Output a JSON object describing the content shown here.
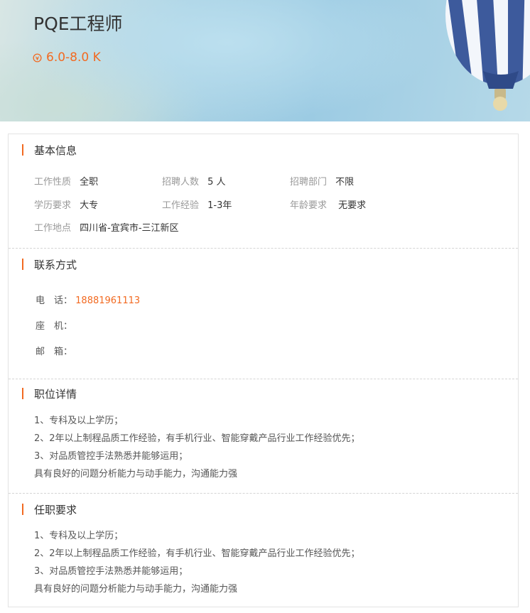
{
  "header": {
    "title": "PQE工程师",
    "salary": "6.0-8.0 K"
  },
  "basic_info": {
    "heading": "基本信息",
    "fields": [
      {
        "label": "工作性质",
        "value": "全职"
      },
      {
        "label": "招聘人数",
        "value": "5 人"
      },
      {
        "label": "招聘部门",
        "value": "不限"
      },
      {
        "label": "学历要求",
        "value": "大专"
      },
      {
        "label": "工作经验",
        "value": "1-3年"
      },
      {
        "label": "年龄要求",
        "value": "无要求"
      },
      {
        "label": "工作地点",
        "value": "四川省-宜宾市-三江新区"
      }
    ]
  },
  "contact": {
    "heading": "联系方式",
    "phone_label": "电　话：",
    "phone": "18881961113",
    "landline_label": "座　机：",
    "email_label": "邮　箱："
  },
  "job_details": {
    "heading": "职位详情",
    "lines": [
      "1、专科及以上学历；",
      "2、2年以上制程品质工作经验，有手机行业、智能穿戴产品行业工作经验优先；",
      "3、对品质管控手法熟悉并能够运用；",
      "具有良好的问题分析能力与动手能力，沟通能力强"
    ]
  },
  "requirements": {
    "heading": "任职要求",
    "lines": [
      "1、专科及以上学历；",
      "2、2年以上制程品质工作经验，有手机行业、智能穿戴产品行业工作经验优先；",
      "3、对品质管控手法熟悉并能够运用；",
      "具有良好的问题分析能力与动手能力，沟通能力强"
    ]
  },
  "colors": {
    "accent": "#f26a21",
    "label": "#999999",
    "border": "#e3e3e3"
  },
  "icons": {
    "salary": "coin-icon",
    "hero_decoration": "hot-air-balloon-icon"
  }
}
